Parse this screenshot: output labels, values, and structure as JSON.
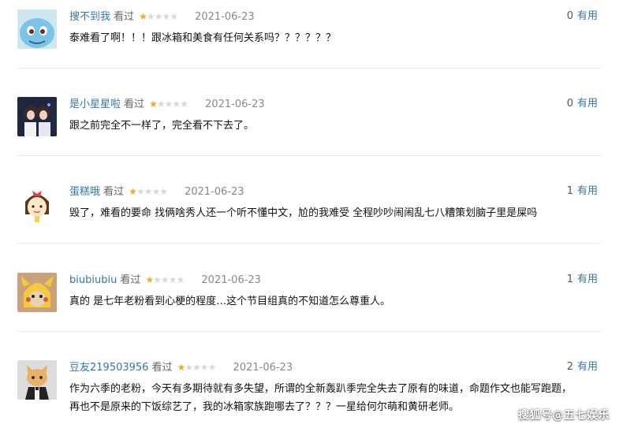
{
  "reviews": [
    {
      "user": "搜不到我",
      "watched": "看过",
      "rating": 1,
      "date": "2021-06-23",
      "useful_count": "0",
      "useful_label": "有用",
      "content": "泰难看了啊！！！跟冰箱和美食有任何关系吗？？？？？？",
      "avatar": "squirtle-avatar"
    },
    {
      "user": "是小星星啦",
      "watched": "看过",
      "rating": 1,
      "date": "2021-06-23",
      "useful_count": "0",
      "useful_label": "有用",
      "content": "跟之前完全不一样了，完全看不下去了。",
      "avatar": "girls-photo-avatar"
    },
    {
      "user": "蛋糕哦",
      "watched": "看过",
      "rating": 1,
      "date": "2021-06-23",
      "useful_count": "1",
      "useful_label": "有用",
      "content": "毁了，难看的要命 找俩啥秀人还一个听不懂中文，尬的我难受 全程吵吵闹闹乱七八糟策划脑子里是屎吗",
      "avatar": "cartoon-girl-avatar"
    },
    {
      "user": "biubiubiu",
      "watched": "看过",
      "rating": 1,
      "date": "2021-06-23",
      "useful_count": "1",
      "useful_label": "有用",
      "content": "真的 是七年老粉看到心梗的程度…这个节目组真的不知道怎么尊重人。",
      "avatar": "pikachu-dog-avatar"
    },
    {
      "user": "豆友219503956",
      "watched": "看过",
      "rating": 1,
      "date": "2021-06-23",
      "useful_count": "2",
      "useful_label": "有用",
      "content": "作为六季的老粉，今天有多期待就有多失望，所谓的全新轰趴季完全失去了原有的味道，命题作文也能写跑题，再也不是原来的下饭综艺了，我的冰箱家族跑哪去了？？？一星给何尔萌和黄研老师。",
      "avatar": "cat-photo-avatar"
    }
  ],
  "watermark": "搜狐号@五七娱乐",
  "colors": {
    "username": "#3377aa",
    "star_on": "#f5a623",
    "star_off": "#d8d8d8",
    "divider": "#ececec"
  }
}
